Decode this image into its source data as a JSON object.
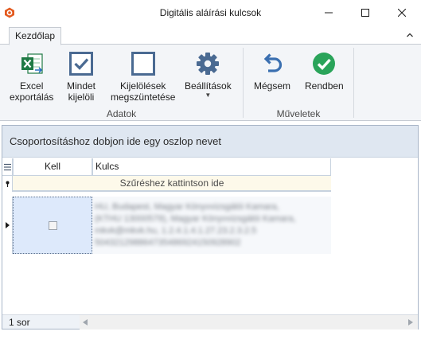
{
  "window": {
    "title": "Digitális aláírási kulcsok"
  },
  "ribbon": {
    "tab_active": "Kezdőlap",
    "groups": {
      "adatok_label": "Adatok",
      "muveletek_label": "Műveletek"
    },
    "buttons": {
      "excel": "Excel exportálás",
      "excel_l1": "Excel",
      "excel_l2": "exportálás",
      "mindet_l1": "Mindet",
      "mindet_l2": "kijelöli",
      "kijel_l1": "Kijelölések",
      "kijel_l2": "megszüntetése",
      "beallitasok": "Beállítások",
      "megsem": "Mégsem",
      "rendben": "Rendben"
    }
  },
  "grid": {
    "group_panel_text": "Csoportosításhoz dobjon ide egy oszlop nevet",
    "columns": [
      "Kell",
      "Kulcs"
    ],
    "filter_prompt": "Szűréshez kattintson ide",
    "rows": [
      {
        "kell": false,
        "kulcs_lines": [
          "HU, Budapest, Magyar Könyvvizsgálói Kamara,",
          "(KTHU 13000579), Magyar Könyvvizsgálói Kamara,",
          "mkvk@mkvk.hu, 1.2.4.1.4.1.27.23.2.3.2.5",
          "504321298864735486924150928902"
        ]
      }
    ],
    "row_count": "1 sor"
  },
  "colors": {
    "excel_green": "#1f7a45",
    "icon_blue": "#4a6a92",
    "ok_green": "#2aa45a",
    "undo_blue": "#3a6fb0",
    "app_orange": "#e35a1f"
  }
}
